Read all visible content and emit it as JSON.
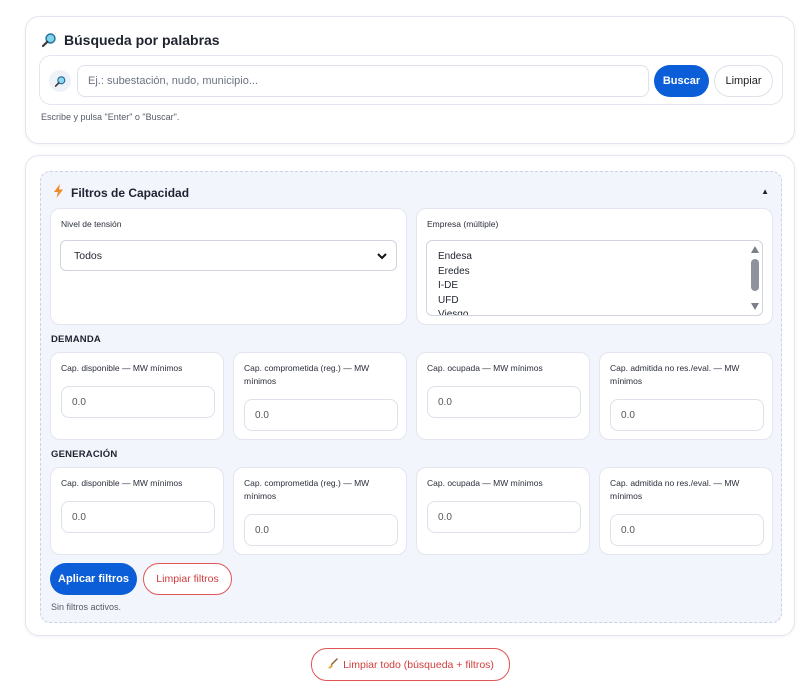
{
  "search": {
    "title": "Búsqueda por palabras",
    "placeholder": "Ej.: subestación, nudo, municipio...",
    "search_label": "Buscar",
    "clear_label": "Limpiar",
    "hint": "Escribe y pulsa \"Enter\" o \"Buscar\"."
  },
  "filters": {
    "title": "Filtros de Capacidad",
    "expanded": true,
    "voltage": {
      "label": "Nivel de tensión",
      "selected": "Todos"
    },
    "company": {
      "label": "Empresa (múltiple)",
      "options": [
        "Endesa",
        "Eredes",
        "I-DE",
        "UFD",
        "Viesgo"
      ]
    },
    "demand": {
      "title": "DEMANDA",
      "fields": [
        {
          "label": "Cap. disponible — MW mínimos",
          "placeholder": "0.0"
        },
        {
          "label": "Cap. comprometida (reg.) — MW mínimos",
          "placeholder": "0.0"
        },
        {
          "label": "Cap. ocupada — MW mínimos",
          "placeholder": "0.0"
        },
        {
          "label": "Cap. admitida no res./eval. — MW mínimos",
          "placeholder": "0.0"
        }
      ]
    },
    "generation": {
      "title": "GENERACIÓN",
      "fields": [
        {
          "label": "Cap. disponible — MW mínimos",
          "placeholder": "0.0"
        },
        {
          "label": "Cap. comprometida (reg.) — MW mínimos",
          "placeholder": "0.0"
        },
        {
          "label": "Cap. ocupada — MW mínimos",
          "placeholder": "0.0"
        },
        {
          "label": "Cap. admitida no res./eval. — MW mínimos",
          "placeholder": "0.0"
        }
      ]
    },
    "apply_label": "Aplicar filtros",
    "clear_label": "Limpiar filtros",
    "status": "Sin filtros activos."
  },
  "clear_all_label": "Limpiar todo (búsqueda + filtros)",
  "colors": {
    "primary": "#0b5ed7",
    "danger": "#d23c3c",
    "panel_bg": "#f3f5fd"
  }
}
